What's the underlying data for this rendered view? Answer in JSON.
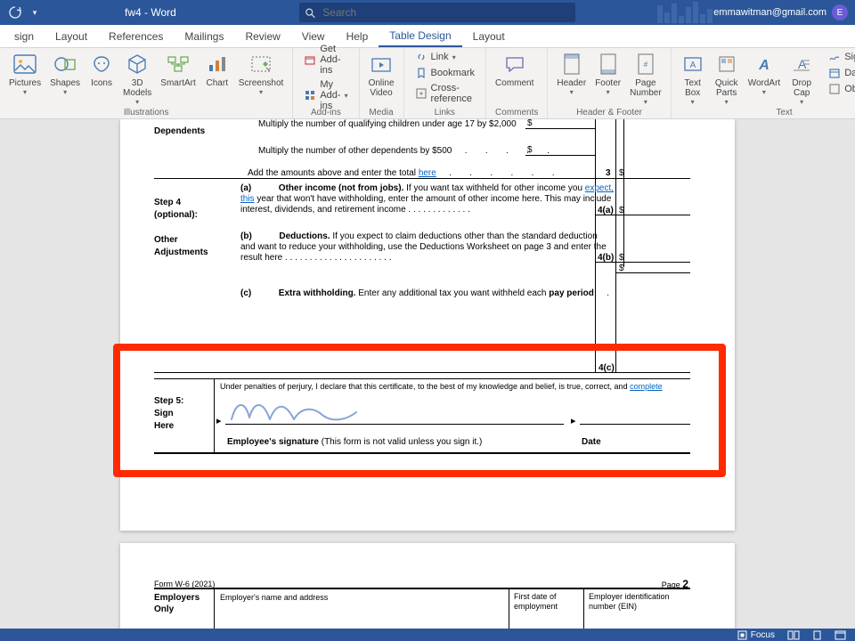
{
  "titlebar": {
    "doc_title": "fw4 - Word",
    "search_placeholder": "Search",
    "user_email": "emmawitman@gmail.com",
    "user_initial": "E"
  },
  "tabs": {
    "t0": "sign",
    "t1": "Layout",
    "t2": "References",
    "t3": "Mailings",
    "t4": "Review",
    "t5": "View",
    "t6": "Help",
    "t7": "Table Design",
    "t8": "Layout"
  },
  "ribbon": {
    "illustrations": {
      "pictures": "Pictures",
      "shapes": "Shapes",
      "icons": "Icons",
      "models": "3D\nModels",
      "smartart": "SmartArt",
      "chart": "Chart",
      "screenshot": "Screenshot",
      "label": "Illustrations"
    },
    "addins": {
      "get": "Get Add-ins",
      "my": "My Add-ins",
      "label": "Add-ins"
    },
    "media": {
      "online_video": "Online\nVideo",
      "label": "Media"
    },
    "links": {
      "link": "Link",
      "bookmark": "Bookmark",
      "cross": "Cross-reference",
      "label": "Links"
    },
    "comments": {
      "comment": "Comment",
      "label": "Comments"
    },
    "hf": {
      "header": "Header",
      "footer": "Footer",
      "page": "Page\nNumber",
      "label": "Header & Footer"
    },
    "text": {
      "textbox": "Text\nBox",
      "quick": "Quick\nParts",
      "wordart": "WordArt",
      "drop": "Drop\nCap",
      "sig": "Signature",
      "dt": "Date & Ti",
      "obj": "Object",
      "label": "Text"
    }
  },
  "doc": {
    "dependents": "Dependents",
    "mult_children": "Multiply the number of qualifying children under age 17 by $2,000",
    "mult_other": "Multiply the number of other dependents by $500",
    "add_total_prefix": "Add the amounts above and enter the total ",
    "add_total_link": "here",
    "three": "3",
    "step4a": "Step 4 (optional):",
    "step4b": "Other Adjustments",
    "s4a_letter": "(a)",
    "s4a_title": "Other income (not from jobs).",
    "s4a_body1": " If you want tax withheld for other income you ",
    "s4a_link": "expect, this",
    "s4a_body2": " year that won't have withholding, enter the amount of other income here. This may include interest, dividends, and retirement income . . . . . . . . . . . . .",
    "l4a": "4(a)",
    "s4b_letter": "(b)",
    "s4b_title": "Deductions.",
    "s4b_body": " If you expect to claim deductions other than the standard deduction",
    "s4b_body2": " and want to reduce your withholding, use the Deductions Worksheet on page 3 and enter the result here . . . . . . . . . . . . . . . . . . . . . .",
    "l4b": "4(b)",
    "s4c_letter": "(c)",
    "s4c_title": "Extra withholding.",
    "s4c_body": " Enter any additional tax you want withheld each ",
    "s4c_bold2": "pay period",
    "l4c": "4(c)",
    "step5": "Step 5:",
    "sign_here": "Sign\nHere",
    "perjury1": "Under penalties of perjury, I declare that this certificate, to the best of my knowledge and belief, is true, correct, and ",
    "perjury_link": "complete",
    "emp_sig": "Employee's signature",
    "emp_sig2": " (This form is not valid unless you sign it.)",
    "date": "Date",
    "dollar": "$",
    "form_no": "Form W-6 (2021)",
    "page_lbl": "Page",
    "page_no": "2",
    "employers": "Employers Only",
    "emp_name": "Employer's name and address",
    "first_date": "First date of employment",
    "ein": "Employer identification number (EIN)"
  },
  "status": {
    "focus": "Focus"
  }
}
